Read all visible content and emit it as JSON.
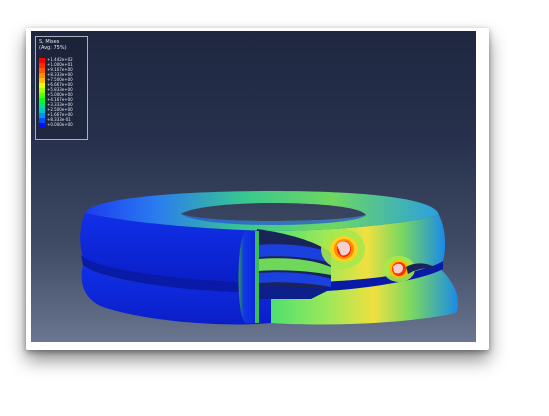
{
  "legend": {
    "title_line1": "S, Mises",
    "title_line2": "(Avg: 75%)",
    "entries": [
      {
        "label": "+1.442e+02",
        "color": "#ff0000"
      },
      {
        "label": "+1.000e+01",
        "color": "#ff2a00"
      },
      {
        "label": "+9.167e+00",
        "color": "#ff5a00"
      },
      {
        "label": "+8.333e+00",
        "color": "#ff8c00"
      },
      {
        "label": "+7.500e+00",
        "color": "#ffc000"
      },
      {
        "label": "+6.667e+00",
        "color": "#e8ff00"
      },
      {
        "label": "+5.833e+00",
        "color": "#a8ff00"
      },
      {
        "label": "+5.000e+00",
        "color": "#5aff00"
      },
      {
        "label": "+4.167e+00",
        "color": "#00ff2a"
      },
      {
        "label": "+3.333e+00",
        "color": "#00e67a"
      },
      {
        "label": "+2.500e+00",
        "color": "#00c8c8"
      },
      {
        "label": "+1.667e+00",
        "color": "#0090ff"
      },
      {
        "label": "+8.333e-01",
        "color": "#0050ff"
      },
      {
        "label": "+0.000e+00",
        "color": "#0010ff"
      }
    ]
  },
  "colors": {
    "background_top": "#1f2740",
    "background_bottom": "#6a7690",
    "low_stress": "#0a22e0",
    "mid_stress": "#3fd06a",
    "high_stress": "#ff2000"
  }
}
